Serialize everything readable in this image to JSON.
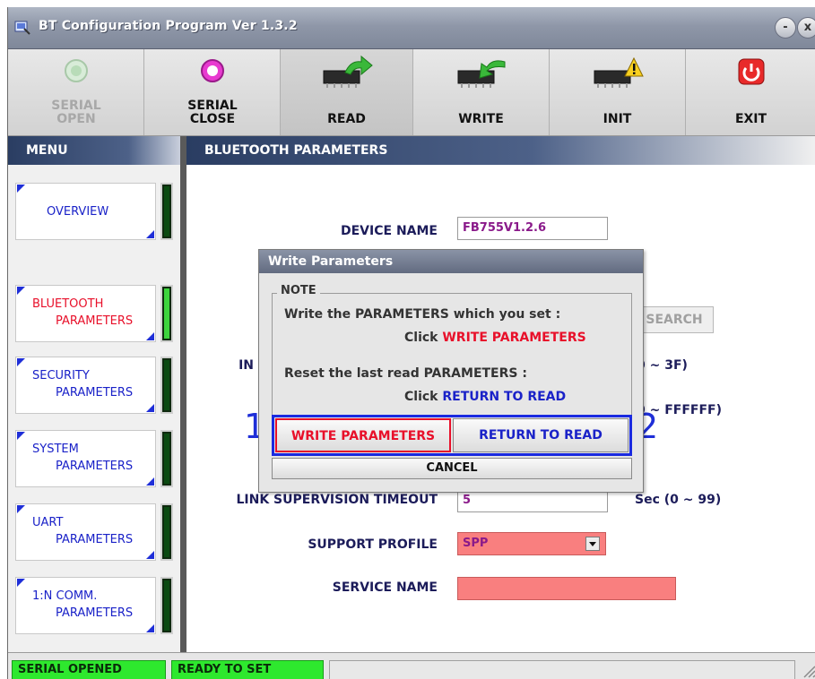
{
  "window": {
    "title": "BT Configuration Program Ver 1.3.2",
    "min_label": "-",
    "close_label": "x"
  },
  "toolbar": {
    "serial_open": "SERIAL OPEN",
    "serial_close": "SERIAL CLOSE",
    "read": "READ",
    "write": "WRITE",
    "init": "INIT",
    "exit": "EXIT"
  },
  "menu": {
    "header": "MENU",
    "items": [
      {
        "line1": "OVERVIEW",
        "line2": "",
        "active": false
      },
      {
        "line1": "BLUETOOTH",
        "line2": "PARAMETERS",
        "active": true
      },
      {
        "line1": "SECURITY",
        "line2": "PARAMETERS",
        "active": false
      },
      {
        "line1": "SYSTEM",
        "line2": "PARAMETERS",
        "active": false
      },
      {
        "line1": "UART",
        "line2": "PARAMETERS",
        "active": false
      },
      {
        "line1": "1:N COMM.",
        "line2": "PARAMETERS",
        "active": false
      }
    ]
  },
  "content": {
    "header": "BLUETOOTH PARAMETERS",
    "device_name_label": "DEVICE NAME",
    "device_name_value": "FB755V1.2.6",
    "search_label": "SEARCH",
    "row_in_label": "IN",
    "range_1": "0 ~ 3F)",
    "range_2": "0 ~ FFFFFF)",
    "link_timeout_label": "LINK SUPERVISION TIMEOUT",
    "link_timeout_value": "5",
    "link_timeout_range": "Sec (0 ~ 99)",
    "support_profile_label": "SUPPORT PROFILE",
    "support_profile_value": "SPP",
    "service_name_label": "SERVICE NAME",
    "service_name_value": "",
    "marker_1": "1",
    "marker_2": "2"
  },
  "dialog": {
    "title": "Write Parameters",
    "note_label": "NOTE",
    "line1": "Write the PARAMETERS which you set :",
    "line2_prefix": "Click",
    "line2_action": "WRITE PARAMETERS",
    "line3": "Reset the last read PARAMETERS :",
    "line4_prefix": "Click",
    "line4_action": "RETURN TO READ",
    "write_button": "WRITE PARAMETERS",
    "return_button": "RETURN TO READ",
    "cancel_button": "CANCEL"
  },
  "status": {
    "serial": "SERIAL OPENED",
    "ready": "READY TO SET"
  },
  "colors": {
    "accent_blue": "#1a22c8",
    "highlight_red": "#e8102a",
    "status_green": "#2ee82e",
    "input_pink": "#f97f7f"
  }
}
